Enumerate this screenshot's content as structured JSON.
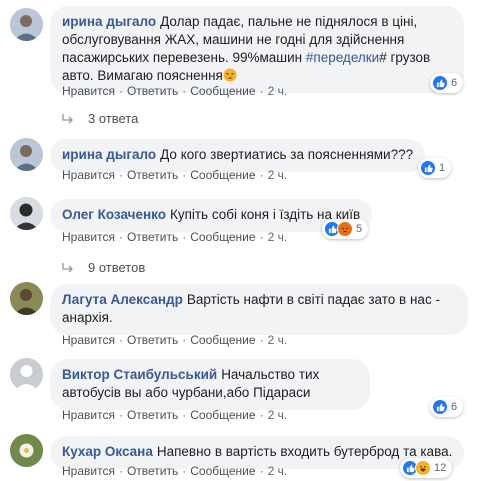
{
  "comments": [
    {
      "author": "ирина дыгало",
      "text_part1": "Долар падає, пальне не піднялося в ціні, обслуговування ЖАХ, машини не годні для здійснення пасажирських перевезень. 99%машин ",
      "hashtag": "#переделки",
      "text_part2": "# грузов авто. Вимагаю пояснення",
      "reaction_count": "6",
      "actions": {
        "like": "Нравится",
        "reply": "Ответить",
        "message": "Сообщение",
        "time": "2 ч."
      },
      "replies_label": "3 ответа"
    },
    {
      "author": "ирина дыгало",
      "text": "До кого звертиатись за поясненнями???",
      "reaction_count": "1",
      "actions": {
        "like": "Нравится",
        "reply": "Ответить",
        "message": "Сообщение",
        "time": "2 ч."
      }
    },
    {
      "author": "Олег Козаченко",
      "text": "Купіть собі коня і їздіть на київ",
      "reaction_count": "5",
      "actions": {
        "like": "Нравится",
        "reply": "Ответить",
        "message": "Сообщение",
        "time": "2 ч."
      },
      "replies_label": "9 ответов"
    },
    {
      "author": "Лагута Александр",
      "text": "Вартість нафти в світі падає зато в нас - анархія.",
      "actions": {
        "like": "Нравится",
        "reply": "Ответить",
        "message": "Сообщение",
        "time": "2 ч."
      }
    },
    {
      "author": "Виктор Стаибульський",
      "text": "Начальство тих автобусів вы або чурбани,або Підараси",
      "reaction_count": "6",
      "actions": {
        "like": "Нравится",
        "reply": "Ответить",
        "message": "Сообщение",
        "time": "2 ч."
      }
    },
    {
      "author": "Кухар Оксана",
      "text": "Напевно в вартість входить бутерброд та кава.",
      "reaction_count": "12",
      "actions": {
        "like": "Нравится",
        "reply": "Ответить",
        "message": "Сообщение",
        "time": "2 ч."
      }
    }
  ],
  "colors": {
    "link": "#385898",
    "bubble": "#f2f3f5",
    "like": "#2078f4",
    "angry": "#e9710f",
    "haha": "#f7b125"
  },
  "icons": [
    "like-icon",
    "angry-icon",
    "haha-icon",
    "reply-arrow-icon",
    "tired-face-emoji"
  ]
}
